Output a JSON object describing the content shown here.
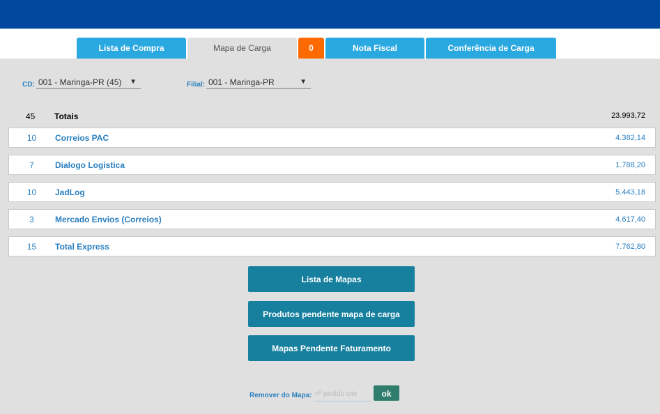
{
  "tabs": [
    {
      "label": "Lista de Compra"
    },
    {
      "label": "Mapa de Carga"
    },
    {
      "label": "0"
    },
    {
      "label": "Nota Fiscal"
    },
    {
      "label": "Conferência de Carga"
    }
  ],
  "filters": {
    "cd_label": "CD:",
    "cd_value": "001 - Maringa-PR (45)",
    "filial_label": "Filial:",
    "filial_value": "001 - Maringa-PR",
    "caret": "▼"
  },
  "totals": {
    "count": "45",
    "label": "Totais",
    "value": "23.993,72"
  },
  "carriers": [
    {
      "count": "10",
      "name": "Correios PAC",
      "value": "4.382,14"
    },
    {
      "count": "7",
      "name": "Dialogo Logistica",
      "value": "1.788,20"
    },
    {
      "count": "10",
      "name": "JadLog",
      "value": "5.443,18"
    },
    {
      "count": "3",
      "name": "Mercado Envios (Correios)",
      "value": "4.617,40"
    },
    {
      "count": "15",
      "name": "Total Express",
      "value": "7.762,80"
    }
  ],
  "buttons": {
    "lista_mapas": "Lista de Mapas",
    "produtos_pendente": "Produtos pendente mapa de carga",
    "mapas_pendente": "Mapas Pendente Faturamento"
  },
  "remove": {
    "label": "Remover do Mapa:",
    "placeholder": "nº pedido site",
    "ok": "ok"
  },
  "colors": {
    "header": "#00479e",
    "tab": "#2aa8e0",
    "badge": "#ff6a00",
    "link": "#2a7fc0",
    "button": "#17809f",
    "ok_button": "#2f7d6d"
  }
}
